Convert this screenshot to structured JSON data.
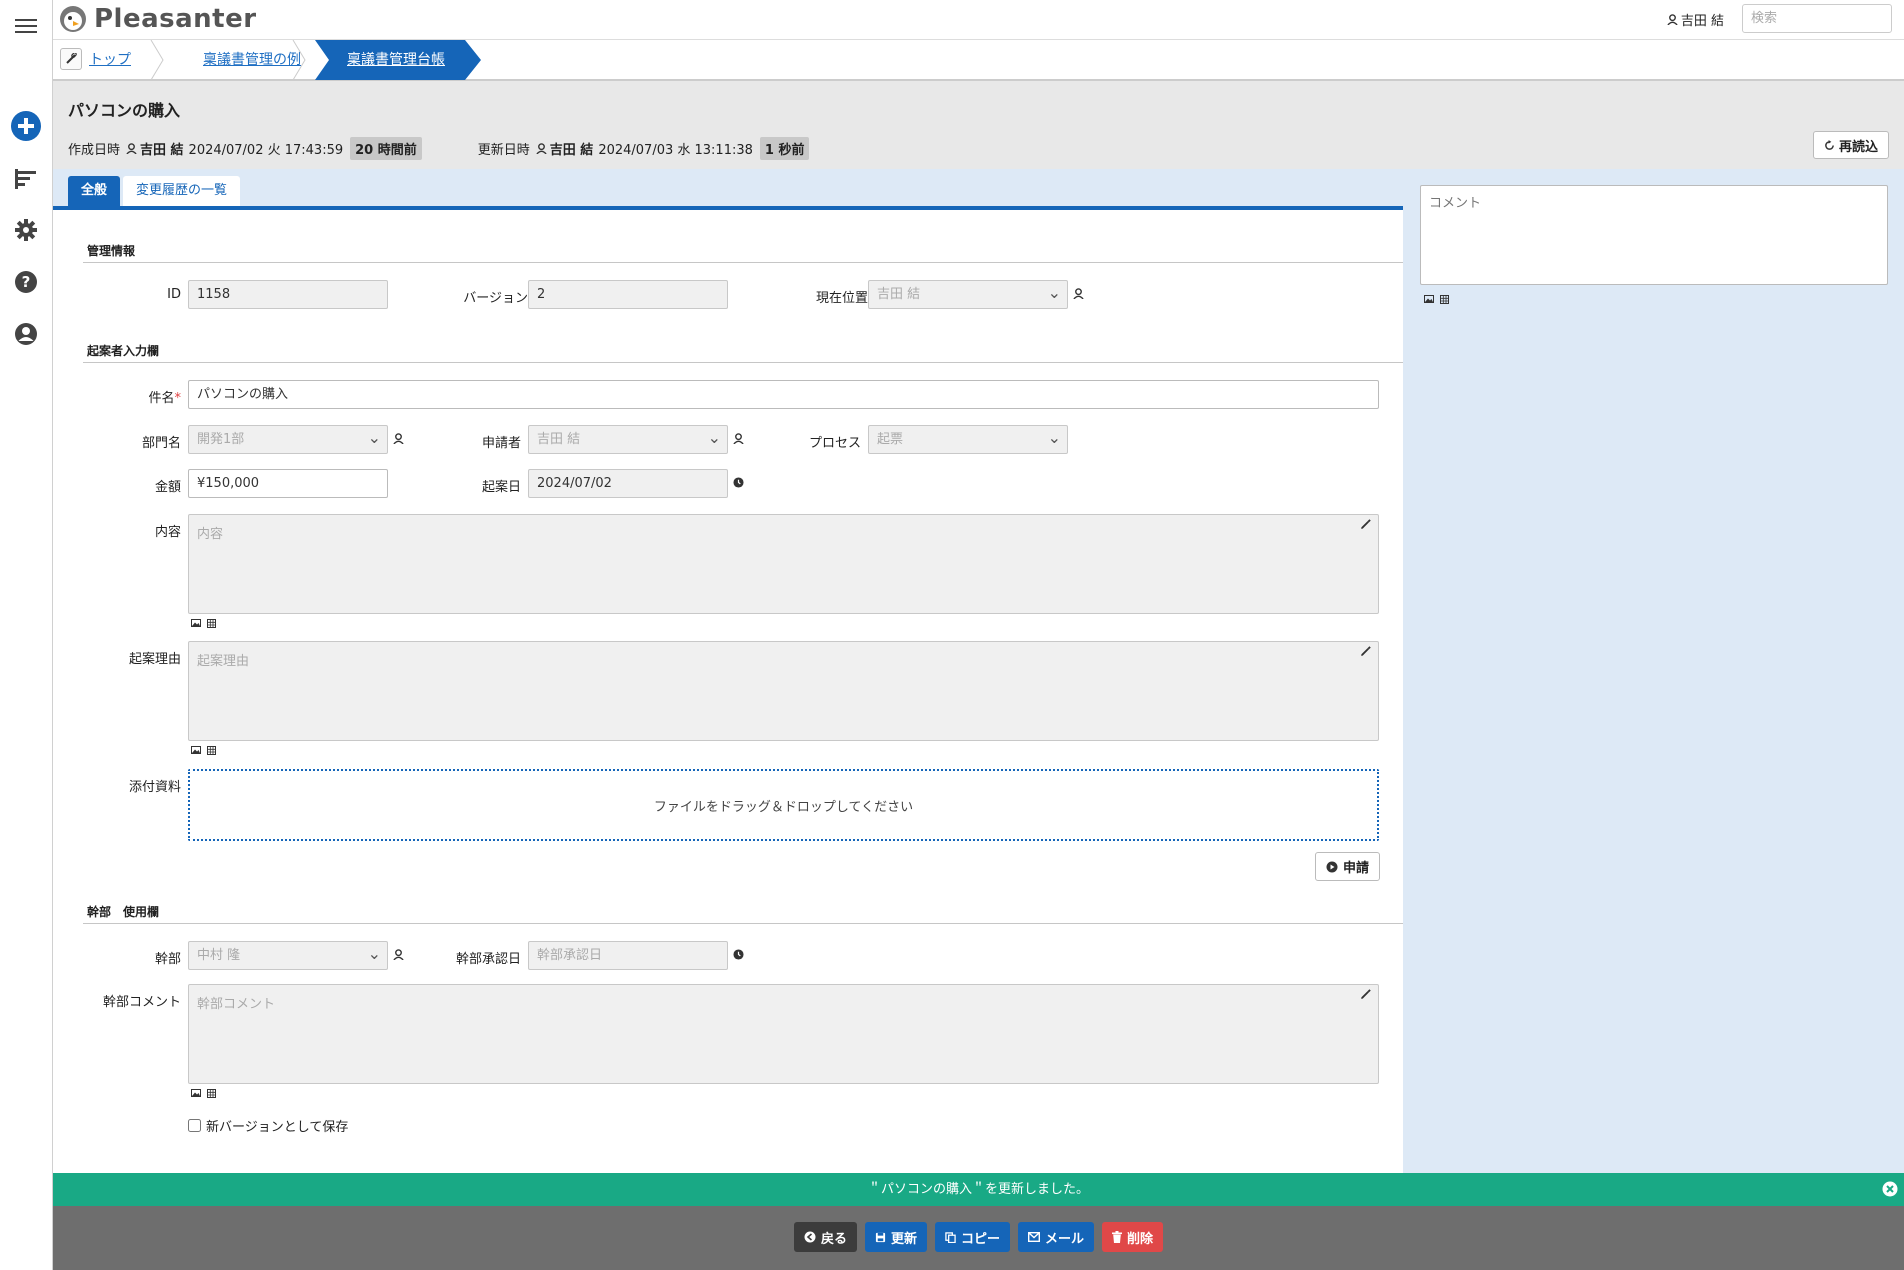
{
  "app": {
    "name": "Pleasanter"
  },
  "header": {
    "user_name": "吉田 結",
    "search_placeholder": "検索"
  },
  "breadcrumb": {
    "items": [
      "トップ",
      "稟議書管理の例",
      "稟議書管理台帳"
    ]
  },
  "record": {
    "title": "パソコンの購入",
    "created_label": "作成日時",
    "created_user": "吉田 結",
    "created_time": "2024/07/02 火 17:43:59",
    "created_ago": "20 時間前",
    "updated_label": "更新日時",
    "updated_user": "吉田 結",
    "updated_time": "2024/07/03 水 13:11:38",
    "updated_ago": "1 秒前",
    "reload_label": "再読込"
  },
  "tabs": [
    "全般",
    "変更履歴の一覧"
  ],
  "comment": {
    "placeholder": "コメント"
  },
  "sections": {
    "admin": "管理情報",
    "drafter": "起案者入力欄",
    "exec": "幹部　使用欄"
  },
  "fields": {
    "id_label": "ID",
    "id_value": "1158",
    "version_label": "バージョン",
    "version_value": "2",
    "location_label": "現在位置",
    "location_value": "吉田 結",
    "subject_label": "件名",
    "subject_required": "*",
    "subject_value": "パソコンの購入",
    "dept_label": "部門名",
    "dept_value": "開発1部",
    "applicant_label": "申請者",
    "applicant_value": "吉田 結",
    "process_label": "プロセス",
    "process_value": "起票",
    "amount_label": "金額",
    "amount_value": "¥150,000",
    "draft_date_label": "起案日",
    "draft_date_value": "2024/07/02",
    "content_label": "内容",
    "content_placeholder": "内容",
    "reason_label": "起案理由",
    "reason_placeholder": "起案理由",
    "attach_label": "添付資料",
    "attach_drop": "ファイルをドラッグ＆ドロップしてください",
    "apply_button": "申請",
    "exec_label": "幹部",
    "exec_value": "中村 隆",
    "exec_date_label": "幹部承認日",
    "exec_date_placeholder": "幹部承認日",
    "exec_comment_label": "幹部コメント",
    "exec_comment_placeholder": "幹部コメント",
    "new_version_label": "新バージョンとして保存"
  },
  "message": "＂パソコンの購入＂を更新しました。",
  "footer": {
    "back": "戻る",
    "update": "更新",
    "copy": "コピー",
    "mail": "メール",
    "delete": "削除"
  },
  "colors": {
    "accent": "#1565b8",
    "success": "#19a985",
    "danger": "#e04848",
    "footer": "#6e6e6e"
  }
}
